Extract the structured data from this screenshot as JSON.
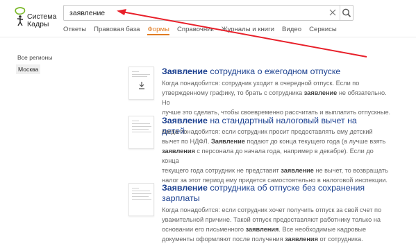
{
  "logo": {
    "line1": "Система",
    "line2": "Кадры",
    "icon": "sistema-kadry-logo-icon"
  },
  "search": {
    "value": "заявление",
    "clear_icon": "close-icon",
    "submit_icon": "search-icon"
  },
  "nav": [
    {
      "label": "Ответы",
      "active": false
    },
    {
      "label": "Правовая база",
      "active": false
    },
    {
      "label": "Формы",
      "active": true
    },
    {
      "label": "Справочник",
      "active": false
    },
    {
      "label": "Журналы и книги",
      "active": false
    },
    {
      "label": "Видео",
      "active": false
    },
    {
      "label": "Сервисы",
      "active": false
    }
  ],
  "sidebar": {
    "all_regions": "Все регионы",
    "selected_region": "Москва"
  },
  "results": [
    {
      "title_kw": "Заявление",
      "title_rest": " сотрудника о ежегодном отпуске",
      "desc": [
        "Когда понадобится: сотрудник уходит в очередной отпуск. Если по",
        "утвержденному графику, то брать с сотрудника |заявление| не обязательно. Но",
        "лучше это сделать, чтобы своевременно рассчитать и выплатить отпускные."
      ]
    },
    {
      "title_kw": "Заявление",
      "title_rest": " на стандартный налоговый вычет на детей",
      "desc": [
        "Когда понадобится: если сотрудник просит предоставлять ему детский",
        "вычет по НДФЛ. |Заявление| подают до конца текущего года (а лучше взять",
        "|заявления| с персонала до начала года, например в декабре). Если до конца",
        "текущего года сотрудник не представит |заявление| не вычет, то возвращать",
        "налог за этот период ему придется самостоятельно в налоговой инспекции."
      ]
    },
    {
      "title_kw": "Заявление",
      "title_rest": " сотрудника об отпуске без сохранения зарплаты",
      "desc": [
        "Когда понадобится: если сотрудник хочет получить отпуск за свой счет по",
        "уважительной причине. Такой отпуск предоставляют работнику только на",
        "основании его письменного |заявления|. Все необходимые кадровые",
        "документы оформляют после получения |заявления| от сотрудника."
      ]
    }
  ],
  "colors": {
    "accent": "#e07b22",
    "link": "#1a3f8f",
    "annotation_arrow": "#e8202a"
  }
}
